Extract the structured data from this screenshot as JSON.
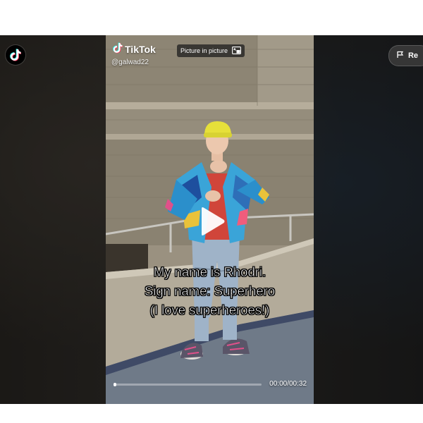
{
  "video": {
    "brand": "TikTok",
    "handle": "@galwad22",
    "pip_label": "Picture in picture",
    "caption_lines": [
      "My name is Rhodri.",
      "Sign name: Superhero",
      "(I love superheroes!)"
    ],
    "time": "00:00/00:32",
    "progress": 0.02
  },
  "report_button": {
    "label": "Re"
  },
  "icons": {
    "corner_logo": "tiktok-logo-icon",
    "brand_logo": "tiktok-note-icon",
    "pip": "picture-in-picture-icon",
    "play": "play-icon",
    "report": "flag-icon"
  },
  "colors": {
    "tiktok_cyan": "#25F4EE",
    "tiktok_red": "#FE2C55",
    "caption_text": "#FFFFFF"
  }
}
